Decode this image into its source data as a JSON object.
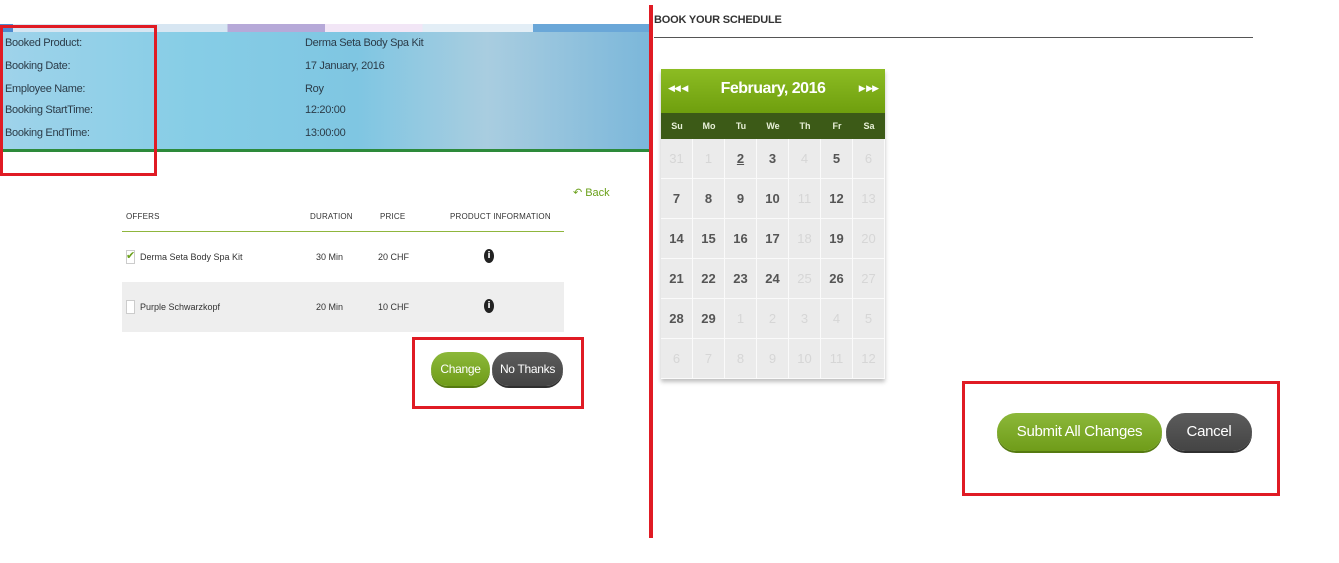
{
  "booking": {
    "fields": [
      {
        "label": "Booked Product:",
        "value": "Derma Seta Body Spa Kit"
      },
      {
        "label": "Booking Date:",
        "value": "17 January, 2016"
      },
      {
        "label": "Employee Name:",
        "value": "Roy"
      },
      {
        "label": "Booking StartTime:",
        "value": "12:20:00"
      },
      {
        "label": "Booking EndTime:",
        "value": "13:00:00"
      }
    ]
  },
  "offers": {
    "back_label": "Back",
    "columns": {
      "offers": "OFFERS",
      "duration": "DURATION",
      "price": "PRICE",
      "info": "PRODUCT INFORMATION"
    },
    "rows": [
      {
        "name": "Derma Seta Body Spa Kit",
        "duration": "30 Min",
        "price": "20 CHF",
        "checked": true
      },
      {
        "name": "Purple Schwarzkopf",
        "duration": "20 Min",
        "price": "10 CHF",
        "checked": false
      }
    ],
    "change_label": "Change",
    "no_thanks_label": "No Thanks"
  },
  "schedule": {
    "title": "BOOK YOUR SCHEDULE",
    "month_label": "February, 2016",
    "weekdays": [
      "Su",
      "Mo",
      "Tu",
      "We",
      "Th",
      "Fr",
      "Sa"
    ],
    "weeks": [
      [
        {
          "d": "31",
          "m": true
        },
        {
          "d": "1",
          "m": true
        },
        {
          "d": "2",
          "t": true
        },
        {
          "d": "3"
        },
        {
          "d": "4",
          "m": true
        },
        {
          "d": "5"
        },
        {
          "d": "6",
          "m": true
        }
      ],
      [
        {
          "d": "7"
        },
        {
          "d": "8"
        },
        {
          "d": "9"
        },
        {
          "d": "10"
        },
        {
          "d": "11",
          "m": true
        },
        {
          "d": "12"
        },
        {
          "d": "13",
          "m": true
        }
      ],
      [
        {
          "d": "14"
        },
        {
          "d": "15"
        },
        {
          "d": "16"
        },
        {
          "d": "17"
        },
        {
          "d": "18",
          "m": true
        },
        {
          "d": "19"
        },
        {
          "d": "20",
          "m": true
        }
      ],
      [
        {
          "d": "21"
        },
        {
          "d": "22"
        },
        {
          "d": "23"
        },
        {
          "d": "24"
        },
        {
          "d": "25",
          "m": true
        },
        {
          "d": "26"
        },
        {
          "d": "27",
          "m": true
        }
      ],
      [
        {
          "d": "28"
        },
        {
          "d": "29"
        },
        {
          "d": "1",
          "m": true
        },
        {
          "d": "2",
          "m": true
        },
        {
          "d": "3",
          "m": true
        },
        {
          "d": "4",
          "m": true
        },
        {
          "d": "5",
          "m": true
        }
      ],
      [
        {
          "d": "6",
          "m": true
        },
        {
          "d": "7",
          "m": true
        },
        {
          "d": "8",
          "m": true
        },
        {
          "d": "9",
          "m": true
        },
        {
          "d": "10",
          "m": true
        },
        {
          "d": "11",
          "m": true
        },
        {
          "d": "12",
          "m": true
        }
      ]
    ],
    "submit_label": "Submit All Changes",
    "cancel_label": "Cancel"
  },
  "colors": {
    "accent_green": "#7aab1e",
    "dark_button": "#4d4d4d",
    "highlight_red": "#e01b24"
  }
}
